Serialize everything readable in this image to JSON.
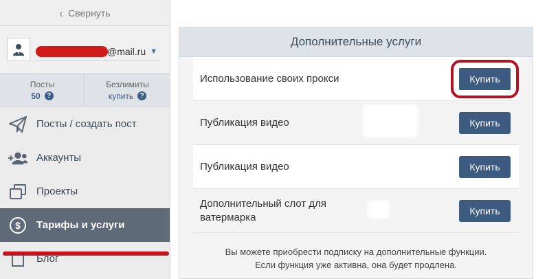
{
  "sidebar": {
    "collapse_label": "Свернуть",
    "user": {
      "email_suffix": "@mail.ru"
    },
    "stats": [
      {
        "label": "Посты",
        "value": "50"
      },
      {
        "label": "Безлимиты",
        "value": "купить"
      }
    ],
    "nav": [
      {
        "label": "Посты / создать пост",
        "icon": "send-icon"
      },
      {
        "label": "Аккаунты",
        "icon": "users-icon"
      },
      {
        "label": "Проекты",
        "icon": "projects-icon"
      },
      {
        "label": "Тарифы и услуги",
        "icon": "dollar-icon",
        "active": true
      },
      {
        "label": "Блог",
        "icon": "blog-icon"
      }
    ]
  },
  "panel": {
    "title": "Дополнительные услуги",
    "rows": [
      {
        "name": "Использование своих прокси",
        "button": "Купить"
      },
      {
        "name": "Публикация видео",
        "button": "Купить"
      },
      {
        "name": "Публикация видео",
        "button": "Купить"
      },
      {
        "name": "Дополнительный слот для ватермарка",
        "button": "Купить"
      }
    ],
    "footer_line1": "Вы можете приобрести подписку на дополнительные функции.",
    "footer_line2": "Если функция уже активна, она будет продлена."
  },
  "colors": {
    "accent": "#3d5a80",
    "active_nav": "#5e6a78",
    "annotation_red": "#c8121b"
  }
}
